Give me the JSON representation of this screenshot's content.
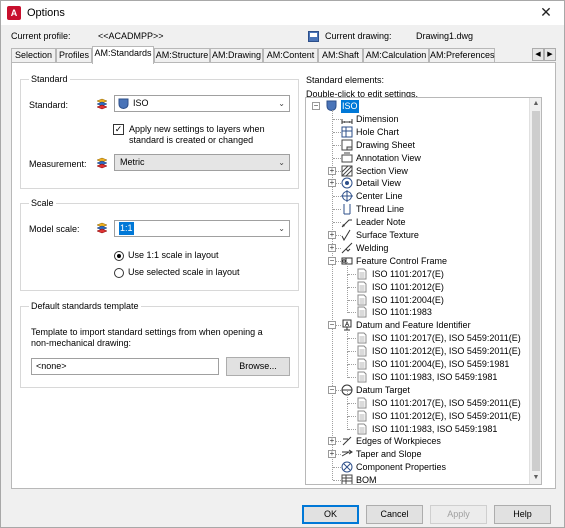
{
  "window": {
    "title": "Options",
    "icon_letter": "A"
  },
  "profile": {
    "current_profile_label": "Current profile:",
    "current_profile_value": "<<ACADMPP>>",
    "current_drawing_label": "Current drawing:",
    "current_drawing_value": "Drawing1.dwg"
  },
  "tabs": [
    "Selection",
    "Profiles",
    "AM:Standards",
    "AM:Structure",
    "AM:Drawing",
    "AM:Content",
    "AM:Shaft",
    "AM:Calculation",
    "AM:Preferences"
  ],
  "active_tab": "AM:Standards",
  "standard_group": {
    "title": "Standard",
    "standard_label": "Standard:",
    "standard_value": "ISO",
    "checkbox_label_line1": "Apply new settings to layers when",
    "checkbox_label_line2": "standard is created or changed",
    "checkbox_checked": true,
    "measurement_label": "Measurement:",
    "measurement_value": "Metric"
  },
  "scale_group": {
    "title": "Scale",
    "model_scale_label": "Model scale:",
    "model_scale_value": "1:1",
    "radio_use_1_1": "Use 1:1 scale in layout",
    "radio_use_selected": "Use selected scale in layout",
    "selected_radio": "use_1_1"
  },
  "template_group": {
    "title": "Default standards template",
    "description_line1": "Template to import standard settings from when opening a",
    "description_line2": "non-mechanical drawing:",
    "template_value": "<none>",
    "browse_label": "Browse..."
  },
  "standard_elements": {
    "title": "Standard elements:",
    "hint": "Double-click to edit settings.",
    "root": "ISO",
    "items": [
      {
        "label": "Dimension",
        "icon": "dimension-icon",
        "level": 1,
        "expander": ""
      },
      {
        "label": "Hole Chart",
        "icon": "hole-chart-icon",
        "level": 1,
        "expander": ""
      },
      {
        "label": "Drawing Sheet",
        "icon": "drawing-sheet-icon",
        "level": 1,
        "expander": ""
      },
      {
        "label": "Annotation View",
        "icon": "annotation-view-icon",
        "level": 1,
        "expander": ""
      },
      {
        "label": "Section View",
        "icon": "section-view-icon",
        "level": 1,
        "expander": "+"
      },
      {
        "label": "Detail View",
        "icon": "detail-view-icon",
        "level": 1,
        "expander": "+"
      },
      {
        "label": "Center Line",
        "icon": "center-line-icon",
        "level": 1,
        "expander": ""
      },
      {
        "label": "Thread Line",
        "icon": "thread-line-icon",
        "level": 1,
        "expander": ""
      },
      {
        "label": "Leader Note",
        "icon": "leader-note-icon",
        "level": 1,
        "expander": ""
      },
      {
        "label": "Surface Texture",
        "icon": "surface-texture-icon",
        "level": 1,
        "expander": "+"
      },
      {
        "label": "Welding",
        "icon": "welding-icon",
        "level": 1,
        "expander": "+"
      },
      {
        "label": "Feature Control Frame",
        "icon": "feature-control-frame-icon",
        "level": 1,
        "expander": "-"
      },
      {
        "label": "ISO 1101:2017(E)",
        "icon": "standard-doc-icon",
        "level": 2,
        "expander": ""
      },
      {
        "label": "ISO 1101:2012(E)",
        "icon": "standard-doc-icon",
        "level": 2,
        "expander": ""
      },
      {
        "label": "ISO 1101:2004(E)",
        "icon": "standard-doc-icon",
        "level": 2,
        "expander": ""
      },
      {
        "label": "ISO 1101:1983",
        "icon": "standard-doc-icon",
        "level": 2,
        "expander": ""
      },
      {
        "label": "Datum and Feature Identifier",
        "icon": "datum-feature-icon",
        "level": 1,
        "expander": "-"
      },
      {
        "label": "ISO 1101:2017(E), ISO 5459:2011(E)",
        "icon": "standard-doc-icon",
        "level": 2,
        "expander": ""
      },
      {
        "label": "ISO 1101:2012(E), ISO 5459:2011(E)",
        "icon": "standard-doc-icon",
        "level": 2,
        "expander": ""
      },
      {
        "label": "ISO 1101:2004(E), ISO 5459:1981",
        "icon": "standard-doc-icon",
        "level": 2,
        "expander": ""
      },
      {
        "label": "ISO 1101:1983, ISO 5459:1981",
        "icon": "standard-doc-icon",
        "level": 2,
        "expander": ""
      },
      {
        "label": "Datum Target",
        "icon": "datum-target-icon",
        "level": 1,
        "expander": "-"
      },
      {
        "label": "ISO 1101:2017(E), ISO 5459:2011(E)",
        "icon": "standard-doc-icon",
        "level": 2,
        "expander": ""
      },
      {
        "label": "ISO 1101:2012(E), ISO 5459:2011(E)",
        "icon": "standard-doc-icon",
        "level": 2,
        "expander": ""
      },
      {
        "label": "ISO 1101:1983, ISO 5459:1981",
        "icon": "standard-doc-icon",
        "level": 2,
        "expander": ""
      },
      {
        "label": "Edges of Workpieces",
        "icon": "edges-icon",
        "level": 1,
        "expander": "+"
      },
      {
        "label": "Taper and Slope",
        "icon": "taper-slope-icon",
        "level": 1,
        "expander": "+"
      },
      {
        "label": "Component Properties",
        "icon": "component-properties-icon",
        "level": 1,
        "expander": ""
      },
      {
        "label": "BOM",
        "icon": "bom-icon",
        "level": 1,
        "expander": ""
      }
    ]
  },
  "footer": {
    "ok": "OK",
    "cancel": "Cancel",
    "apply": "Apply",
    "help": "Help"
  },
  "colors": {
    "accent": "#0078d7",
    "app_icon": "#c8102e",
    "selection": "#0078d7"
  }
}
